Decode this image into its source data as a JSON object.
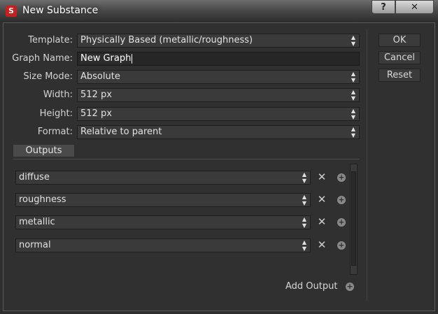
{
  "window": {
    "title": "New Substance",
    "app_icon_letter": "S",
    "help_label": "?",
    "close_label": "✕"
  },
  "form": {
    "template": {
      "label": "Template:",
      "value": "Physically Based (metallic/roughness)"
    },
    "graph_name": {
      "label": "Graph Name:",
      "value": "New Graph"
    },
    "size_mode": {
      "label": "Size Mode:",
      "value": "Absolute"
    },
    "width": {
      "label": "Width:",
      "value": "512 px"
    },
    "height": {
      "label": "Height:",
      "value": "512 px"
    },
    "format": {
      "label": "Format:",
      "value": "Relative to parent"
    }
  },
  "buttons": {
    "ok": "OK",
    "cancel": "Cancel",
    "reset": "Reset"
  },
  "outputs": {
    "tab_label": "Outputs",
    "items": [
      {
        "value": "diffuse"
      },
      {
        "value": "roughness"
      },
      {
        "value": "metallic"
      },
      {
        "value": "normal"
      }
    ],
    "add_label": "Add Output"
  },
  "icons": {
    "remove": "close-x-icon",
    "add": "plus-circle-icon",
    "combo_arrows": "updown-arrows-icon"
  }
}
